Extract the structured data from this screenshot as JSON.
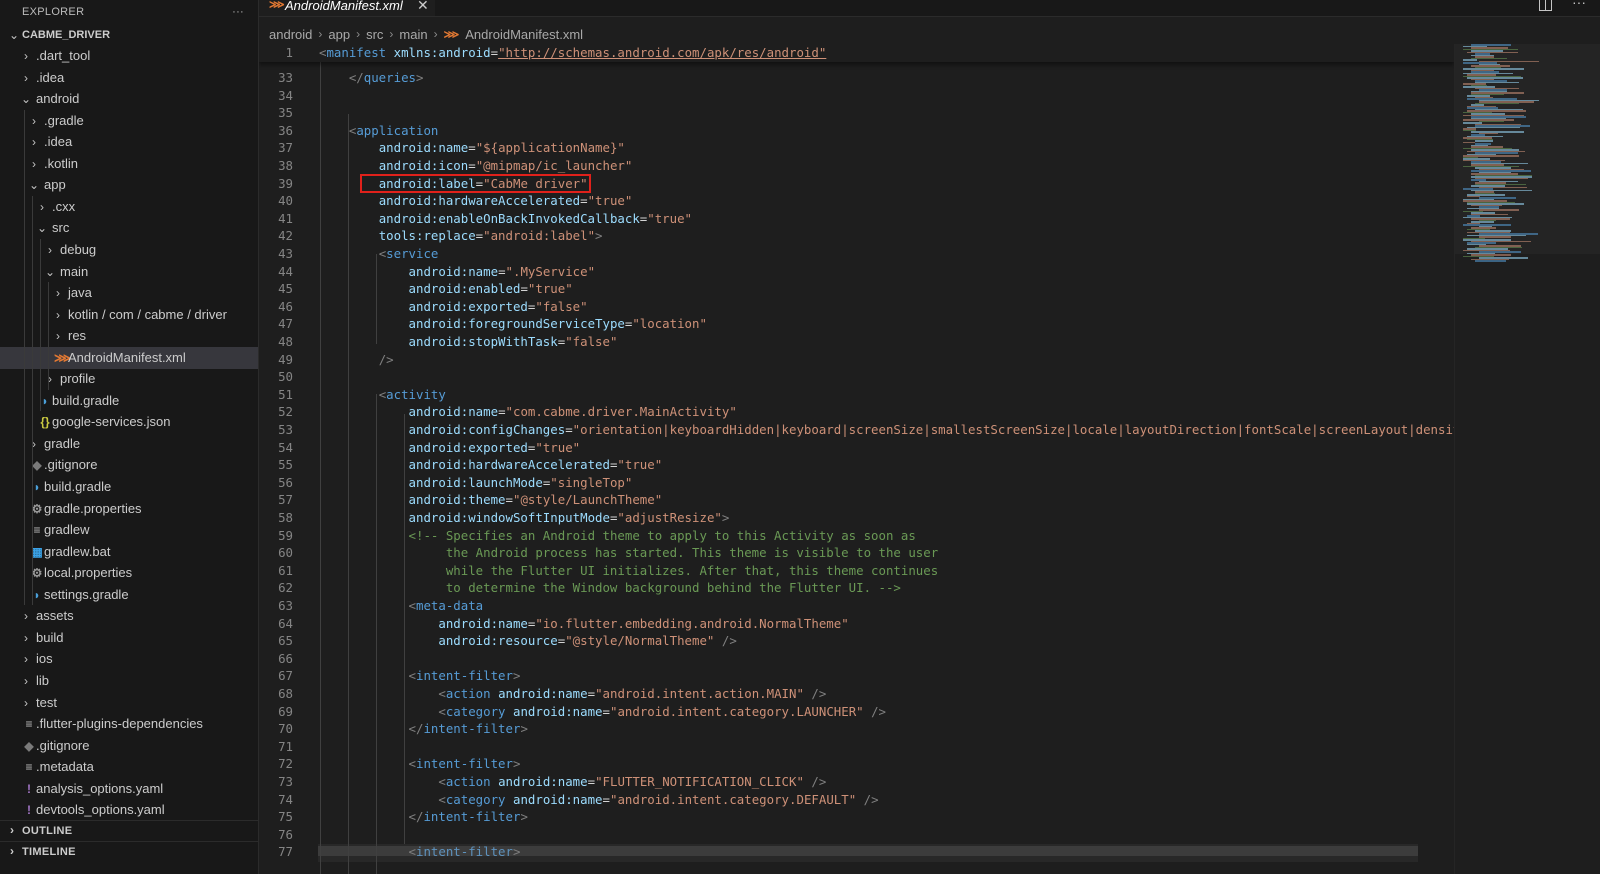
{
  "sidebar": {
    "title": "EXPLORER",
    "more_glyph": "···",
    "root": "CABME_DRIVER",
    "tree": [
      {
        "label": ".dart_tool",
        "kind": "folder",
        "level": 1,
        "expanded": false
      },
      {
        "label": ".idea",
        "kind": "folder",
        "level": 1,
        "expanded": false
      },
      {
        "label": "android",
        "kind": "folder",
        "level": 1,
        "expanded": true
      },
      {
        "label": ".gradle",
        "kind": "folder",
        "level": 2,
        "expanded": false
      },
      {
        "label": ".idea",
        "kind": "folder",
        "level": 2,
        "expanded": false
      },
      {
        "label": ".kotlin",
        "kind": "folder",
        "level": 2,
        "expanded": false
      },
      {
        "label": "app",
        "kind": "folder",
        "level": 2,
        "expanded": true
      },
      {
        "label": ".cxx",
        "kind": "folder",
        "level": 3,
        "expanded": false
      },
      {
        "label": "src",
        "kind": "folder",
        "level": 3,
        "expanded": true
      },
      {
        "label": "debug",
        "kind": "folder",
        "level": 4,
        "expanded": false
      },
      {
        "label": "main",
        "kind": "folder",
        "level": 4,
        "expanded": true
      },
      {
        "label": "java",
        "kind": "folder",
        "level": 5,
        "expanded": false
      },
      {
        "label": "kotlin / com / cabme / driver",
        "kind": "folder",
        "level": 5,
        "expanded": false
      },
      {
        "label": "res",
        "kind": "folder",
        "level": 5,
        "expanded": false
      },
      {
        "label": "AndroidManifest.xml",
        "kind": "xml",
        "level": 5,
        "selected": true
      },
      {
        "label": "profile",
        "kind": "folder",
        "level": 4,
        "expanded": false
      },
      {
        "label": "build.gradle",
        "kind": "gradle",
        "level": 3
      },
      {
        "label": "google-services.json",
        "kind": "json",
        "level": 3
      },
      {
        "label": "gradle",
        "kind": "folder",
        "level": 2,
        "expanded": false
      },
      {
        "label": ".gitignore",
        "kind": "git",
        "level": 2
      },
      {
        "label": "build.gradle",
        "kind": "gradle",
        "level": 2
      },
      {
        "label": "gradle.properties",
        "kind": "gear",
        "level": 2
      },
      {
        "label": "gradlew",
        "kind": "lines",
        "level": 2
      },
      {
        "label": "gradlew.bat",
        "kind": "windows",
        "level": 2
      },
      {
        "label": "local.properties",
        "kind": "gear",
        "level": 2
      },
      {
        "label": "settings.gradle",
        "kind": "gradle",
        "level": 2
      },
      {
        "label": "assets",
        "kind": "folder",
        "level": 1,
        "expanded": false
      },
      {
        "label": "build",
        "kind": "folder",
        "level": 1,
        "expanded": false
      },
      {
        "label": "ios",
        "kind": "folder",
        "level": 1,
        "expanded": false
      },
      {
        "label": "lib",
        "kind": "folder",
        "level": 1,
        "expanded": false
      },
      {
        "label": "test",
        "kind": "folder",
        "level": 1,
        "expanded": false
      },
      {
        "label": ".flutter-plugins-dependencies",
        "kind": "lines",
        "level": 1
      },
      {
        "label": ".gitignore",
        "kind": "git",
        "level": 1
      },
      {
        "label": ".metadata",
        "kind": "lines",
        "level": 1
      },
      {
        "label": "analysis_options.yaml",
        "kind": "yaml",
        "level": 1
      },
      {
        "label": "devtools_options.yaml",
        "kind": "yaml",
        "level": 1
      }
    ],
    "outline_label": "OUTLINE",
    "timeline_label": "TIMELINE"
  },
  "tab": {
    "title": "AndroidManifest.xml",
    "close_glyph": "✕"
  },
  "breadcrumb": [
    "android",
    "app",
    "src",
    "main",
    "AndroidManifest.xml"
  ],
  "editor": {
    "sticky": {
      "n": 1,
      "tokens": [
        [
          "p",
          "<"
        ],
        [
          "t",
          "manifest"
        ],
        [
          "d",
          " "
        ],
        [
          "a",
          "xmlns:android"
        ],
        [
          "d",
          "="
        ],
        [
          "s",
          "\"http://schemas.android.com/apk/res/android\""
        ]
      ]
    },
    "lines": [
      {
        "n": 33,
        "tokens": [
          [
            "d",
            "    "
          ],
          [
            "p",
            "</"
          ],
          [
            "t",
            "queries"
          ],
          [
            "p",
            ">"
          ]
        ]
      },
      {
        "n": 34,
        "tokens": []
      },
      {
        "n": 35,
        "tokens": []
      },
      {
        "n": 36,
        "tokens": [
          [
            "d",
            "    "
          ],
          [
            "p",
            "<"
          ],
          [
            "t",
            "application"
          ]
        ]
      },
      {
        "n": 37,
        "tokens": [
          [
            "d",
            "        "
          ],
          [
            "a",
            "android:name"
          ],
          [
            "d",
            "="
          ],
          [
            "s",
            "\"${applicationName}\""
          ]
        ]
      },
      {
        "n": 38,
        "tokens": [
          [
            "d",
            "        "
          ],
          [
            "a",
            "android:icon"
          ],
          [
            "d",
            "="
          ],
          [
            "s",
            "\"@mipmap/ic_launcher\""
          ]
        ]
      },
      {
        "n": 39,
        "tokens": [
          [
            "d",
            "        "
          ],
          [
            "a",
            "android:label"
          ],
          [
            "d",
            "="
          ],
          [
            "s",
            "\"CabMe driver\""
          ]
        ]
      },
      {
        "n": 40,
        "tokens": [
          [
            "d",
            "        "
          ],
          [
            "a",
            "android:hardwareAccelerated"
          ],
          [
            "d",
            "="
          ],
          [
            "s",
            "\"true\""
          ]
        ]
      },
      {
        "n": 41,
        "tokens": [
          [
            "d",
            "        "
          ],
          [
            "a",
            "android:enableOnBackInvokedCallback"
          ],
          [
            "d",
            "="
          ],
          [
            "s",
            "\"true\""
          ]
        ]
      },
      {
        "n": 42,
        "tokens": [
          [
            "d",
            "        "
          ],
          [
            "a",
            "tools:replace"
          ],
          [
            "d",
            "="
          ],
          [
            "s",
            "\"android:label\""
          ],
          [
            "p",
            ">"
          ]
        ]
      },
      {
        "n": 43,
        "tokens": [
          [
            "d",
            "        "
          ],
          [
            "p",
            "<"
          ],
          [
            "t",
            "service"
          ]
        ]
      },
      {
        "n": 44,
        "tokens": [
          [
            "d",
            "            "
          ],
          [
            "a",
            "android:name"
          ],
          [
            "d",
            "="
          ],
          [
            "s",
            "\".MyService\""
          ]
        ]
      },
      {
        "n": 45,
        "tokens": [
          [
            "d",
            "            "
          ],
          [
            "a",
            "android:enabled"
          ],
          [
            "d",
            "="
          ],
          [
            "s",
            "\"true\""
          ]
        ]
      },
      {
        "n": 46,
        "tokens": [
          [
            "d",
            "            "
          ],
          [
            "a",
            "android:exported"
          ],
          [
            "d",
            "="
          ],
          [
            "s",
            "\"false\""
          ]
        ]
      },
      {
        "n": 47,
        "tokens": [
          [
            "d",
            "            "
          ],
          [
            "a",
            "android:foregroundServiceType"
          ],
          [
            "d",
            "="
          ],
          [
            "s",
            "\"location\""
          ]
        ]
      },
      {
        "n": 48,
        "tokens": [
          [
            "d",
            "            "
          ],
          [
            "a",
            "android:stopWithTask"
          ],
          [
            "d",
            "="
          ],
          [
            "s",
            "\"false\""
          ]
        ]
      },
      {
        "n": 49,
        "tokens": [
          [
            "d",
            "        "
          ],
          [
            "p",
            "/>"
          ]
        ]
      },
      {
        "n": 50,
        "tokens": []
      },
      {
        "n": 51,
        "tokens": [
          [
            "d",
            "        "
          ],
          [
            "p",
            "<"
          ],
          [
            "t",
            "activity"
          ]
        ]
      },
      {
        "n": 52,
        "tokens": [
          [
            "d",
            "            "
          ],
          [
            "a",
            "android:name"
          ],
          [
            "d",
            "="
          ],
          [
            "s",
            "\"com.cabme.driver.MainActivity\""
          ]
        ]
      },
      {
        "n": 53,
        "tokens": [
          [
            "d",
            "            "
          ],
          [
            "a",
            "android:configChanges"
          ],
          [
            "d",
            "="
          ],
          [
            "s",
            "\"orientation|keyboardHidden|keyboard|screenSize|smallestScreenSize|locale|layoutDirection|fontScale|screenLayout|density|uiMode\""
          ]
        ]
      },
      {
        "n": 54,
        "tokens": [
          [
            "d",
            "            "
          ],
          [
            "a",
            "android:exported"
          ],
          [
            "d",
            "="
          ],
          [
            "s",
            "\"true\""
          ]
        ]
      },
      {
        "n": 55,
        "tokens": [
          [
            "d",
            "            "
          ],
          [
            "a",
            "android:hardwareAccelerated"
          ],
          [
            "d",
            "="
          ],
          [
            "s",
            "\"true\""
          ]
        ]
      },
      {
        "n": 56,
        "tokens": [
          [
            "d",
            "            "
          ],
          [
            "a",
            "android:launchMode"
          ],
          [
            "d",
            "="
          ],
          [
            "s",
            "\"singleTop\""
          ]
        ]
      },
      {
        "n": 57,
        "tokens": [
          [
            "d",
            "            "
          ],
          [
            "a",
            "android:theme"
          ],
          [
            "d",
            "="
          ],
          [
            "s",
            "\"@style/LaunchTheme\""
          ]
        ]
      },
      {
        "n": 58,
        "tokens": [
          [
            "d",
            "            "
          ],
          [
            "a",
            "android:windowSoftInputMode"
          ],
          [
            "d",
            "="
          ],
          [
            "s",
            "\"adjustResize\""
          ],
          [
            "p",
            ">"
          ]
        ]
      },
      {
        "n": 59,
        "tokens": [
          [
            "d",
            "            "
          ],
          [
            "c",
            "<!-- Specifies an Android theme to apply to this Activity as soon as"
          ]
        ]
      },
      {
        "n": 60,
        "tokens": [
          [
            "c",
            "                 the Android process has started. This theme is visible to the user"
          ]
        ]
      },
      {
        "n": 61,
        "tokens": [
          [
            "c",
            "                 while the Flutter UI initializes. After that, this theme continues"
          ]
        ]
      },
      {
        "n": 62,
        "tokens": [
          [
            "c",
            "                 to determine the Window background behind the Flutter UI. -->"
          ]
        ]
      },
      {
        "n": 63,
        "tokens": [
          [
            "d",
            "            "
          ],
          [
            "p",
            "<"
          ],
          [
            "t",
            "meta-data"
          ]
        ]
      },
      {
        "n": 64,
        "tokens": [
          [
            "d",
            "                "
          ],
          [
            "a",
            "android:name"
          ],
          [
            "d",
            "="
          ],
          [
            "s",
            "\"io.flutter.embedding.android.NormalTheme\""
          ]
        ]
      },
      {
        "n": 65,
        "tokens": [
          [
            "d",
            "                "
          ],
          [
            "a",
            "android:resource"
          ],
          [
            "d",
            "="
          ],
          [
            "s",
            "\"@style/NormalTheme\""
          ],
          [
            "d",
            " "
          ],
          [
            "p",
            "/>"
          ]
        ]
      },
      {
        "n": 66,
        "tokens": []
      },
      {
        "n": 67,
        "tokens": [
          [
            "d",
            "            "
          ],
          [
            "p",
            "<"
          ],
          [
            "t",
            "intent-filter"
          ],
          [
            "p",
            ">"
          ]
        ]
      },
      {
        "n": 68,
        "tokens": [
          [
            "d",
            "                "
          ],
          [
            "p",
            "<"
          ],
          [
            "t",
            "action"
          ],
          [
            "d",
            " "
          ],
          [
            "a",
            "android:name"
          ],
          [
            "d",
            "="
          ],
          [
            "s",
            "\"android.intent.action.MAIN\""
          ],
          [
            "d",
            " "
          ],
          [
            "p",
            "/>"
          ]
        ]
      },
      {
        "n": 69,
        "tokens": [
          [
            "d",
            "                "
          ],
          [
            "p",
            "<"
          ],
          [
            "t",
            "category"
          ],
          [
            "d",
            " "
          ],
          [
            "a",
            "android:name"
          ],
          [
            "d",
            "="
          ],
          [
            "s",
            "\"android.intent.category.LAUNCHER\""
          ],
          [
            "d",
            " "
          ],
          [
            "p",
            "/>"
          ]
        ]
      },
      {
        "n": 70,
        "tokens": [
          [
            "d",
            "            "
          ],
          [
            "p",
            "</"
          ],
          [
            "t",
            "intent-filter"
          ],
          [
            "p",
            ">"
          ]
        ]
      },
      {
        "n": 71,
        "tokens": []
      },
      {
        "n": 72,
        "tokens": [
          [
            "d",
            "            "
          ],
          [
            "p",
            "<"
          ],
          [
            "t",
            "intent-filter"
          ],
          [
            "p",
            ">"
          ]
        ]
      },
      {
        "n": 73,
        "tokens": [
          [
            "d",
            "                "
          ],
          [
            "p",
            "<"
          ],
          [
            "t",
            "action"
          ],
          [
            "d",
            " "
          ],
          [
            "a",
            "android:name"
          ],
          [
            "d",
            "="
          ],
          [
            "s",
            "\"FLUTTER_NOTIFICATION_CLICK\""
          ],
          [
            "d",
            " "
          ],
          [
            "p",
            "/>"
          ]
        ]
      },
      {
        "n": 74,
        "tokens": [
          [
            "d",
            "                "
          ],
          [
            "p",
            "<"
          ],
          [
            "t",
            "category"
          ],
          [
            "d",
            " "
          ],
          [
            "a",
            "android:name"
          ],
          [
            "d",
            "="
          ],
          [
            "s",
            "\"android.intent.category.DEFAULT\""
          ],
          [
            "d",
            " "
          ],
          [
            "p",
            "/>"
          ]
        ]
      },
      {
        "n": 75,
        "tokens": [
          [
            "d",
            "            "
          ],
          [
            "p",
            "</"
          ],
          [
            "t",
            "intent-filter"
          ],
          [
            "p",
            ">"
          ]
        ]
      },
      {
        "n": 76,
        "tokens": []
      },
      {
        "n": 77,
        "tokens": [
          [
            "d",
            "            "
          ],
          [
            "p",
            "<"
          ],
          [
            "t",
            "intent-filter"
          ],
          [
            "p",
            ">"
          ]
        ]
      }
    ],
    "highlighted_line": 39
  },
  "colors": {
    "highlight_box": "#e0211b",
    "xml_icon": "#e37933",
    "tag": "#569cd6",
    "attr": "#9cdcfe",
    "string": "#ce9178",
    "comment": "#6a9955"
  }
}
